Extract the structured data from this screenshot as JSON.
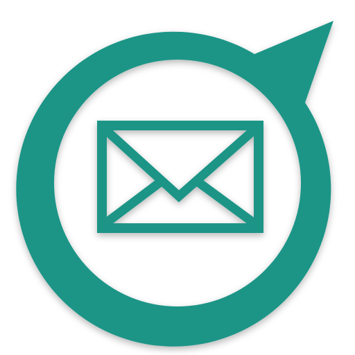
{
  "icon": {
    "name": "mail-chat-bubble-icon",
    "glyph": "envelope-icon",
    "colors": {
      "brand": "#1c9587",
      "background": "#ffffff",
      "shadow": "#000000"
    }
  }
}
